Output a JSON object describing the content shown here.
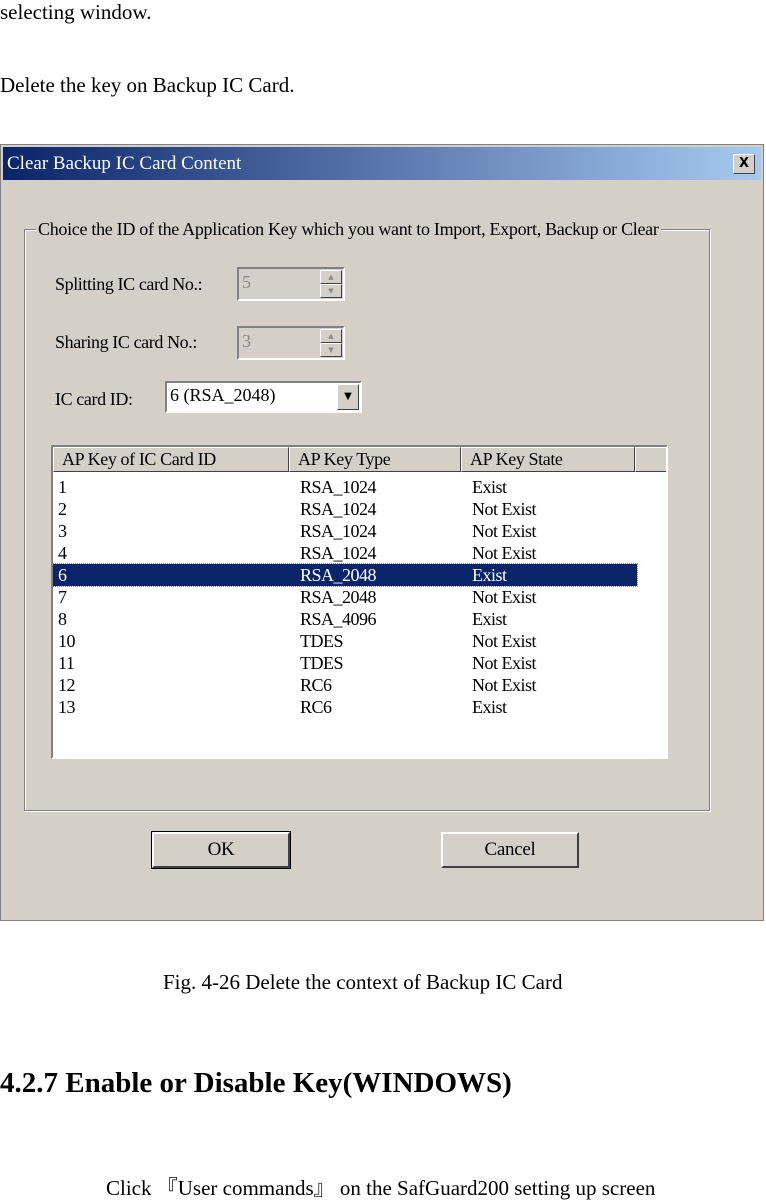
{
  "document": {
    "line1": "selecting window.",
    "line2": "Delete the key on Backup IC Card.",
    "caption": "Fig. 4-26  Delete the context of Backup IC Card",
    "heading": "4.2.7 Enable or Disable Key(WINDOWS)",
    "click_line": "Click 『User commands』 on the SafGuard200 setting up screen"
  },
  "dialog": {
    "title": "Clear Backup IC Card Content",
    "close_label": "X",
    "group_label": "Choice the ID of the Application Key which you want to Import, Export, Backup or Clear",
    "splitting_label": "Splitting IC card No.:",
    "splitting_value": "5",
    "sharing_label": "Sharing IC card No.:",
    "sharing_value": "3",
    "card_id_label": "IC card ID:",
    "card_id_value": "6 (RSA_2048)",
    "columns": [
      "AP Key of IC Card ID",
      "AP Key Type",
      "AP Key State"
    ],
    "rows": [
      {
        "id": "1",
        "type": "RSA_1024",
        "state": "Exist"
      },
      {
        "id": "2",
        "type": "RSA_1024",
        "state": "Not Exist"
      },
      {
        "id": "3",
        "type": "RSA_1024",
        "state": "Not Exist"
      },
      {
        "id": "4",
        "type": "RSA_1024",
        "state": "Not Exist"
      },
      {
        "id": "6",
        "type": "RSA_2048",
        "state": "Exist",
        "selected": true
      },
      {
        "id": "7",
        "type": "RSA_2048",
        "state": "Not Exist"
      },
      {
        "id": "8",
        "type": "RSA_4096",
        "state": "Exist"
      },
      {
        "id": "10",
        "type": "TDES",
        "state": "Not Exist"
      },
      {
        "id": "11",
        "type": "TDES",
        "state": "Not Exist"
      },
      {
        "id": "12",
        "type": "RC6",
        "state": "Not Exist"
      },
      {
        "id": "13",
        "type": "RC6",
        "state": "Exist"
      }
    ],
    "ok_label": "OK",
    "cancel_label": "Cancel"
  },
  "icons": {
    "spin_up": "▲",
    "spin_down": "▼",
    "combo_arrow": "▼"
  },
  "colors": {
    "selection": "#0a246a",
    "face": "#d4d0c8"
  }
}
